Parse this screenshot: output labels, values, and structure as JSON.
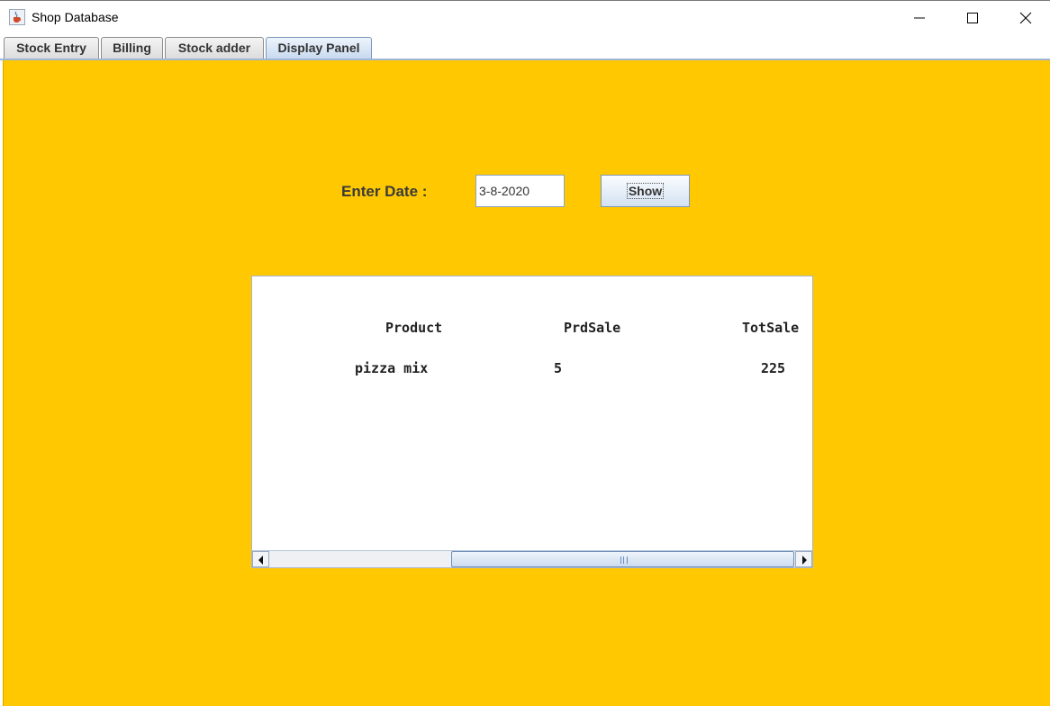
{
  "window": {
    "title": "Shop Database"
  },
  "tabs": [
    {
      "label": "Stock Entry"
    },
    {
      "label": "Billing"
    },
    {
      "label": "Stock adder"
    },
    {
      "label": "Display Panel",
      "active": true
    }
  ],
  "form": {
    "date_label": "Enter Date :",
    "date_value": "3-8-2020",
    "show_label": "Show"
  },
  "report": {
    "columns": [
      "Product",
      "PrdSale",
      "TotSale"
    ],
    "rows": [
      [
        "pizza mix",
        "5",
        "225"
      ]
    ]
  },
  "colors": {
    "panel_background": "#ffc800",
    "accent": "#c8daf0"
  }
}
